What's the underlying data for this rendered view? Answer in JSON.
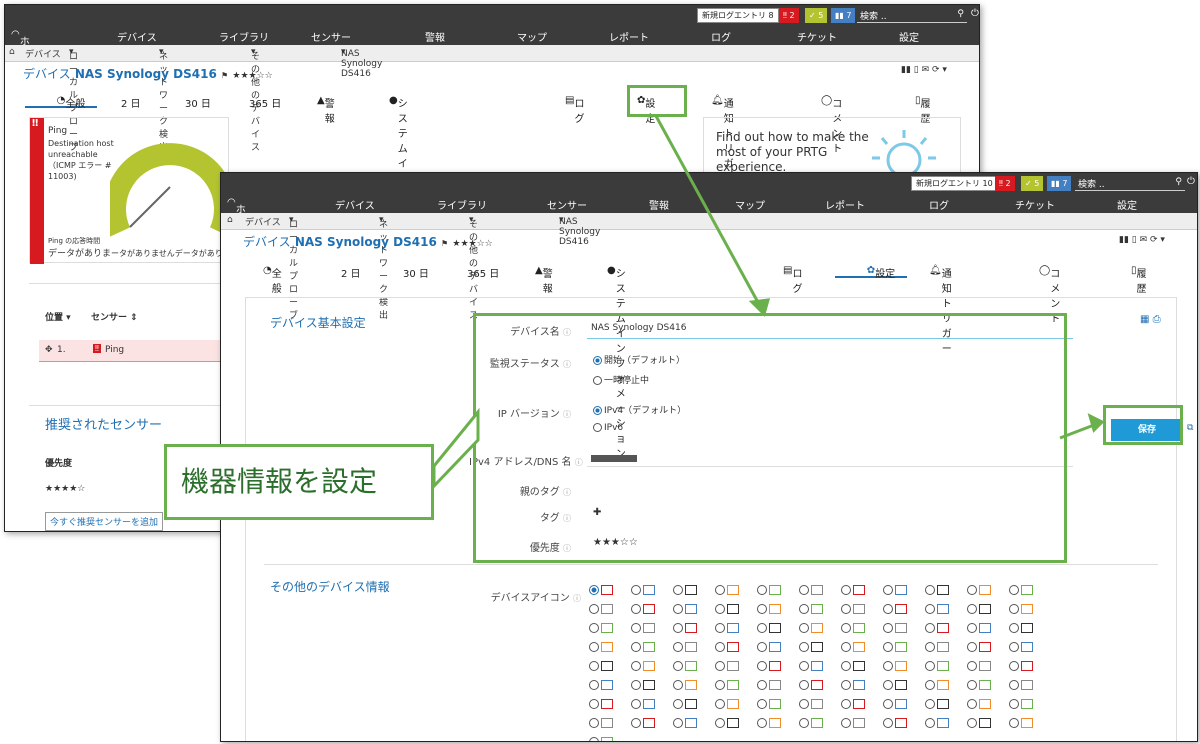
{
  "nav": {
    "home": "ホーム",
    "devices": "デバイス",
    "library": "ライブラリ",
    "sensors": "センサー",
    "alarms": "警報",
    "map": "マップ",
    "reports": "レポート",
    "logs": "ログ",
    "tickets": "チケット",
    "setup": "設定"
  },
  "w1": {
    "new_log": "新規ログエントリ",
    "new_log_count": "8",
    "b_red": "2",
    "b_green": "5",
    "b_blue": "7",
    "search": "検索 ..",
    "crumbs": [
      "デバイス",
      "ローカルプローブ",
      "ネットワーク検出",
      "その他のデバイス",
      "NAS Synology DS416"
    ],
    "title_prefix": "デバイス",
    "title_name": "NAS Synology DS416",
    "stars": "★★★☆☆",
    "tabs": [
      "全般",
      "2 日",
      "30 日",
      "365 日",
      "警報",
      "システムインフォメーション",
      "ログ",
      "設定",
      "通知トリガー",
      "コメント",
      "履歴"
    ],
    "ping_title": "Ping",
    "ping_msg": "Destination host unreachable （ICMP エラー # 11003)",
    "ping_resp": "Ping の応答時間",
    "nodata": "データがありま",
    "nodata2": "ータがありませんデータがありま",
    "col_pos": "位置",
    "col_sensor": "センサー",
    "row_pos": "1.",
    "row_sensor": "Ping",
    "recommended": "推奨されたセンサー",
    "priority": "優先度",
    "rec_stars": "★★★★☆",
    "add_btn": "今すぐ推奨センサーを追加",
    "promo": "Find out how to make the most of your PRTG experience."
  },
  "w2": {
    "new_log": "新規ログエントリ",
    "new_log_count": "10",
    "b_red": "2",
    "b_green": "5",
    "b_blue": "7",
    "search": "検索 ..",
    "crumbs": [
      "デバイス",
      "ローカルプローブ",
      "ネットワーク検出",
      "その他のデバイス",
      "NAS Synology DS416"
    ],
    "title_prefix": "デバイス",
    "title_name": "NAS Synology DS416",
    "stars": "★★★☆☆",
    "tabs": [
      "全般",
      "2 日",
      "30 日",
      "365 日",
      "警報",
      "システムインフォメーション",
      "ログ",
      "設定",
      "通知トリガー",
      "コメント",
      "履歴"
    ],
    "basic": "デバイス基本設定",
    "f_name": "デバイス名",
    "v_name": "NAS Synology DS416",
    "f_status": "監視ステータス",
    "v_status1": "開始（デフォルト）",
    "v_status2": "一時停止中",
    "f_ip": "IP バージョン",
    "v_ip1": "IPv4（デフォルト）",
    "v_ip2": "IPv6",
    "f_addr": "IPv4 アドレス/DNS 名",
    "f_parent": "親のタグ",
    "f_tags": "タグ",
    "v_tag": "✚",
    "f_prio": "優先度",
    "v_prio": "★★★☆☆",
    "other": "その他のデバイス情報",
    "f_icon": "デバイスアイコン",
    "save": "保存"
  },
  "annotation": "機器情報を設定"
}
